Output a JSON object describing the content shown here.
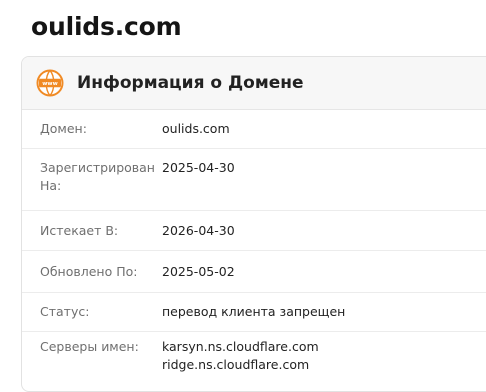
{
  "page": {
    "title": "oulids.com"
  },
  "card": {
    "title": "Информация о Домене",
    "icon": "www-globe-icon",
    "accent_color": "#f08a24"
  },
  "rows": [
    {
      "label": "Домен:",
      "value": "oulids.com"
    },
    {
      "label": "Зарегистрирован На:",
      "value": "2025-04-30"
    },
    {
      "label": "Истекает В:",
      "value": "2026-04-30"
    },
    {
      "label": "Обновлено По:",
      "value": "2025-05-02"
    },
    {
      "label": "Статус:",
      "value": "перевод клиента запрещен"
    },
    {
      "label": "Серверы имен:",
      "values": [
        "karsyn.ns.cloudflare.com",
        "ridge.ns.cloudflare.com"
      ]
    }
  ]
}
